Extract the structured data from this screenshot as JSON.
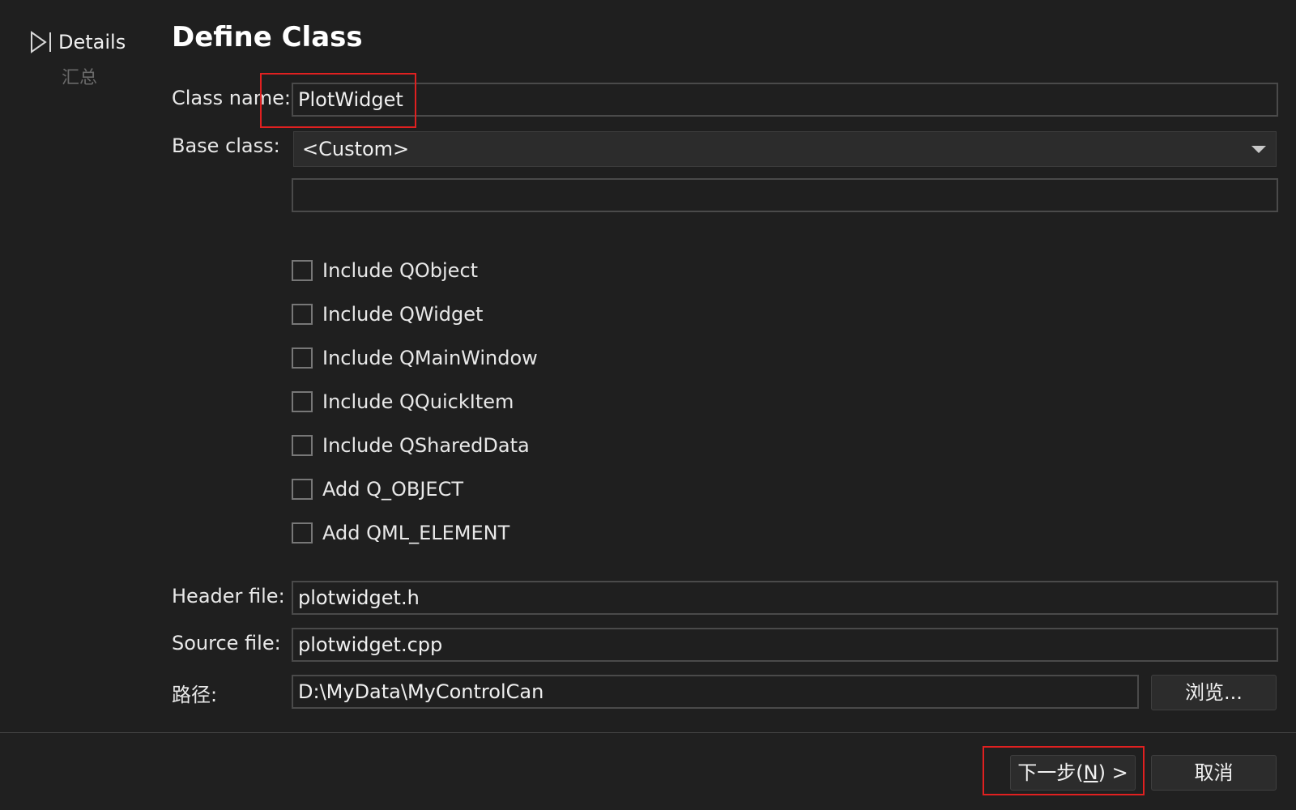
{
  "steps": {
    "current_label": "Details",
    "next_label": "汇总"
  },
  "page": {
    "title": "Define Class"
  },
  "form": {
    "class_name_label": "Class name:",
    "class_name_value": "PlotWidget",
    "base_class_label": "Base class:",
    "base_class_value": "<Custom>",
    "custom_base_value": "",
    "header_file_label": "Header file:",
    "header_file_value": "plotwidget.h",
    "source_file_label": "Source file:",
    "source_file_value": "plotwidget.cpp",
    "path_label": "路径:",
    "path_value": "D:\\MyData\\MyControlCan",
    "browse_label": "浏览..."
  },
  "options": [
    {
      "label": "Include QObject",
      "checked": false
    },
    {
      "label": "Include QWidget",
      "checked": false
    },
    {
      "label": "Include QMainWindow",
      "checked": false
    },
    {
      "label": "Include QQuickItem",
      "checked": false
    },
    {
      "label": "Include QSharedData",
      "checked": false
    },
    {
      "label": "Add Q_OBJECT",
      "checked": false
    },
    {
      "label": "Add QML_ELEMENT",
      "checked": false
    }
  ],
  "footer": {
    "next_prefix": "下一步(",
    "next_mnemonic": "N",
    "next_suffix": ") >",
    "cancel_label": "取消"
  },
  "colors": {
    "background": "#1f1f1f",
    "highlight": "#e02020"
  }
}
